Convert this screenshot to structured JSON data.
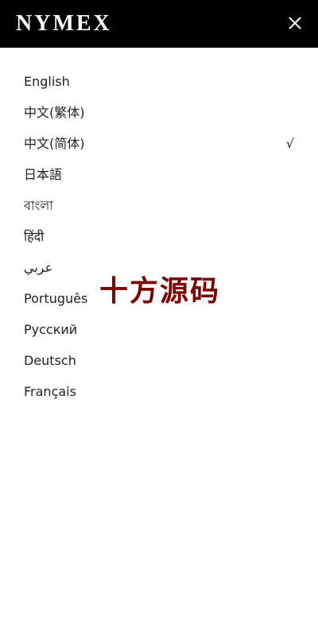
{
  "header": {
    "logo": "NYMEX",
    "close_icon": "close-icon"
  },
  "languages": [
    {
      "label": "English",
      "selected": false
    },
    {
      "label": "中文(繁体)",
      "selected": false
    },
    {
      "label": "中文(简体)",
      "selected": true
    },
    {
      "label": "日本語",
      "selected": false
    },
    {
      "label": "বাংলা",
      "selected": false
    },
    {
      "label": "हिंदी",
      "selected": false
    },
    {
      "label": "عربي",
      "selected": false
    },
    {
      "label": "Português",
      "selected": false
    },
    {
      "label": "Русский",
      "selected": false
    },
    {
      "label": "Deutsch",
      "selected": false
    },
    {
      "label": "Français",
      "selected": false
    }
  ],
  "selected_mark": "√",
  "watermark": "十方源码",
  "colors": {
    "header_bg": "#000000",
    "header_text": "#ffffff",
    "text": "#222222",
    "watermark": "#7a0000"
  }
}
